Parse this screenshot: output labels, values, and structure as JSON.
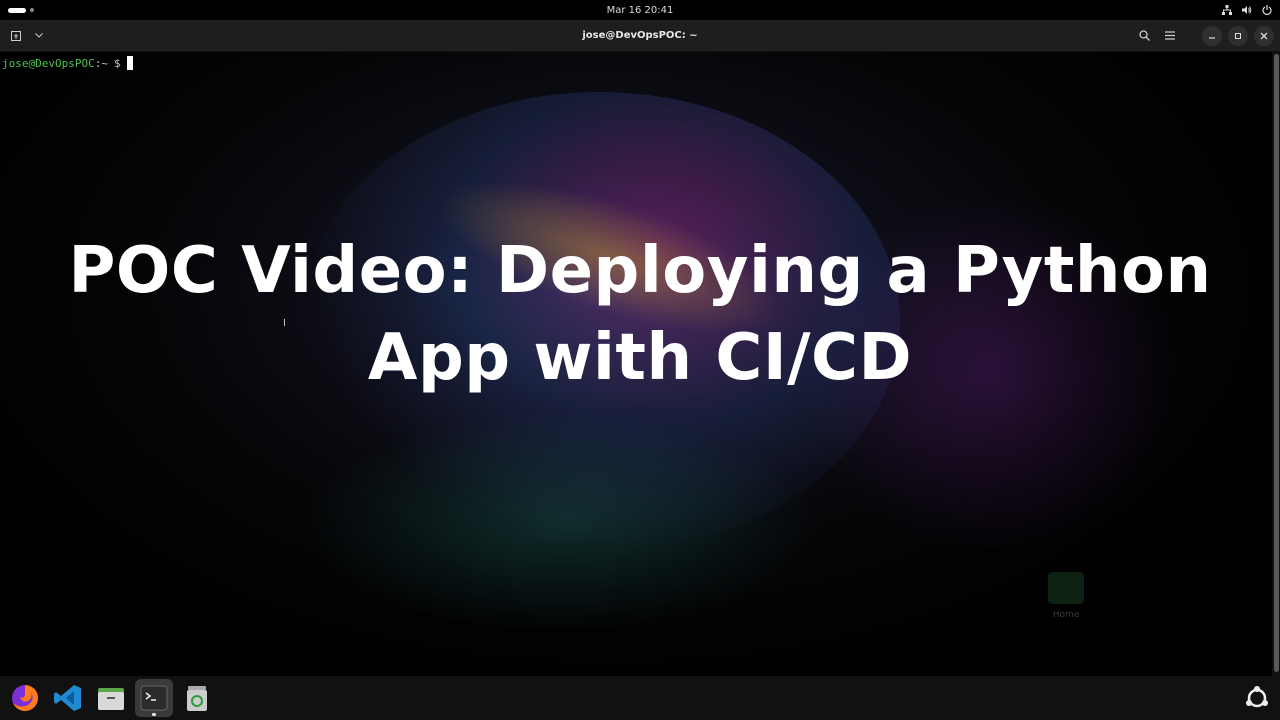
{
  "topbar": {
    "clock": "Mar 16  20:41",
    "tray_icons": [
      "network-icon",
      "volume-icon",
      "power-icon"
    ]
  },
  "window": {
    "title": "jose@DevOpsPOC: ~",
    "buttons": [
      "new-tab-icon",
      "tab-menu-icon",
      "search-icon",
      "hamburger-menu-icon",
      "minimize-icon",
      "restore-icon",
      "close-icon"
    ]
  },
  "terminal": {
    "prompt_user": "jose@DevOpsPOC",
    "prompt_path": ":~",
    "prompt_symbol": "$"
  },
  "overlay": {
    "title_line1": "POC Video: Deploying a Python",
    "title_line2": "App with CI/CD"
  },
  "desktop": {
    "home_label": "Home"
  },
  "dock": {
    "items": [
      "firefox-icon",
      "vscode-icon",
      "files-icon",
      "terminal-icon",
      "trash-icon"
    ],
    "active": "terminal-icon"
  },
  "colors": {
    "prompt_user": "#4ec04e",
    "headerbar": "#1e1e1e",
    "dock": "#111111"
  }
}
